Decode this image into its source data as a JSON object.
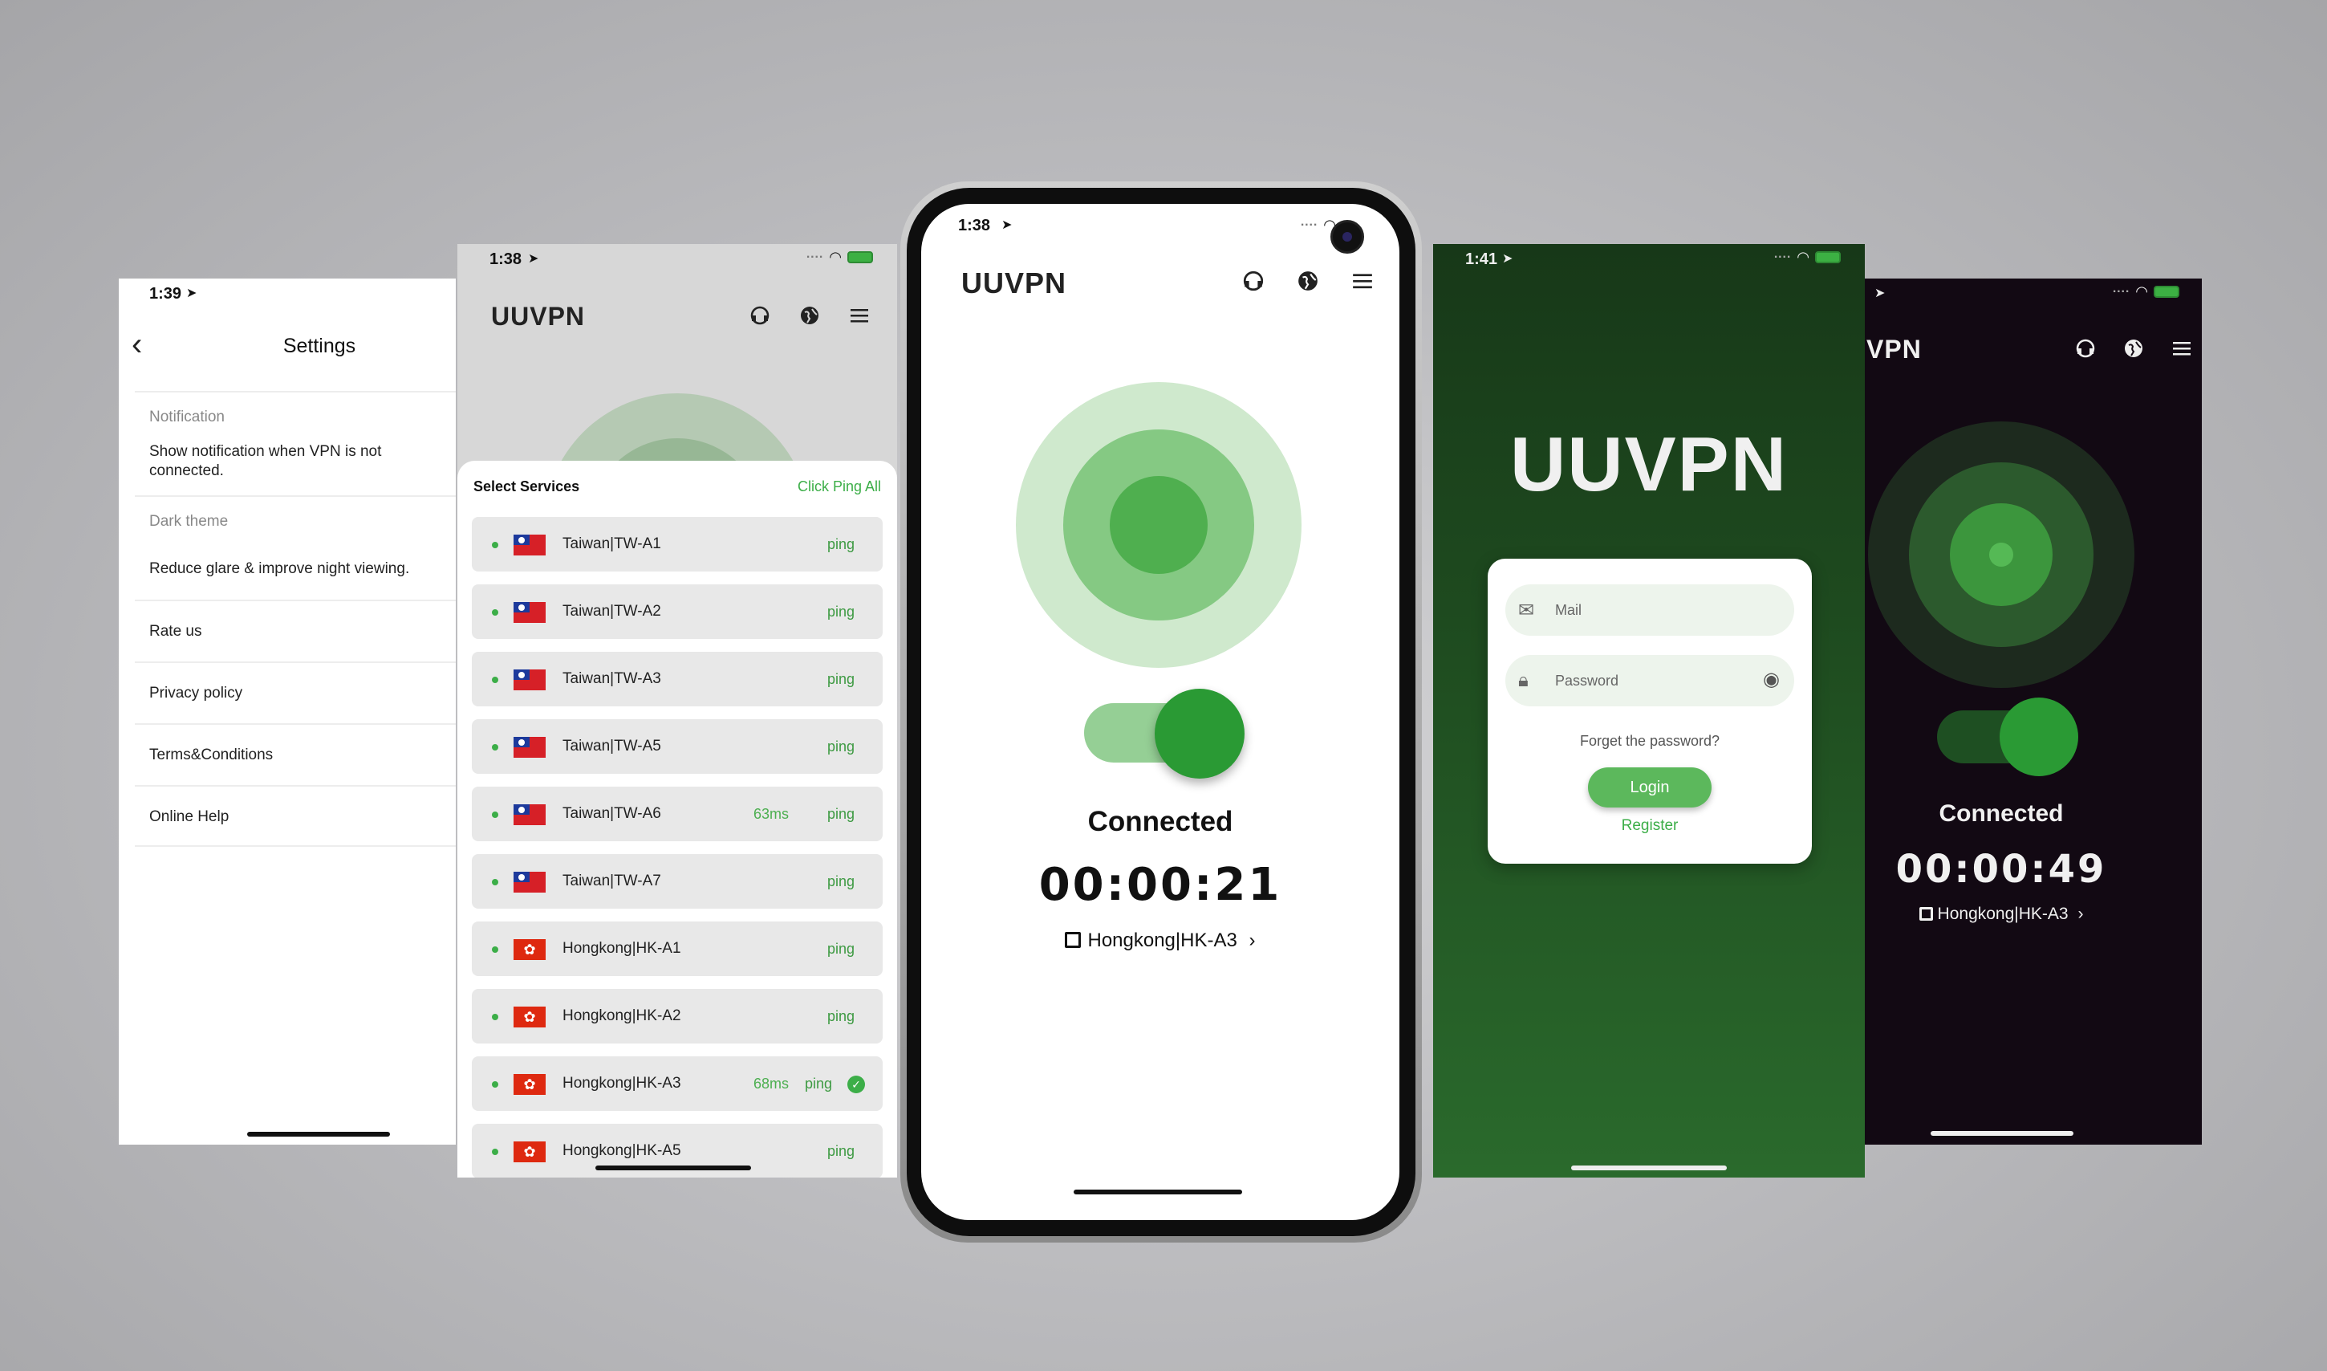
{
  "settings": {
    "time": "1:39",
    "title": "Settings",
    "back_glyph": "‹",
    "rows": [
      {
        "label": "Notification",
        "text": "Show notification when VPN is not connected."
      },
      {
        "label": "Dark theme",
        "text": "Reduce glare & improve night viewing."
      },
      {
        "label": "",
        "text": "Rate us"
      },
      {
        "label": "",
        "text": "Privacy policy"
      },
      {
        "label": "",
        "text": "Terms&Conditions"
      },
      {
        "label": "",
        "text": "Online Help"
      }
    ]
  },
  "server_list": {
    "time": "1:38",
    "brand": "UUVPN",
    "sheet_title": "Select Services",
    "ping_all": "Click Ping All",
    "servers": [
      {
        "name": "Taiwan|TW-A1",
        "latency": "",
        "action": "ping",
        "flag": "tw"
      },
      {
        "name": "Taiwan|TW-A2",
        "latency": "",
        "action": "ping",
        "flag": "tw"
      },
      {
        "name": "Taiwan|TW-A3",
        "latency": "",
        "action": "ping",
        "flag": "tw"
      },
      {
        "name": "Taiwan|TW-A5",
        "latency": "",
        "action": "ping",
        "flag": "tw"
      },
      {
        "name": "Taiwan|TW-A6",
        "latency": "63ms",
        "action": "ping",
        "flag": "tw"
      },
      {
        "name": "Taiwan|TW-A7",
        "latency": "",
        "action": "ping",
        "flag": "tw"
      },
      {
        "name": "Hongkong|HK-A1",
        "latency": "",
        "action": "ping",
        "flag": "hk"
      },
      {
        "name": "Hongkong|HK-A2",
        "latency": "",
        "action": "ping",
        "flag": "hk"
      },
      {
        "name": "Hongkong|HK-A3",
        "latency": "68ms",
        "action": "ping",
        "flag": "hk",
        "selected": true
      },
      {
        "name": "Hongkong|HK-A5",
        "latency": "",
        "action": "ping",
        "flag": "hk"
      }
    ]
  },
  "main": {
    "time": "1:38",
    "brand": "UUVPN",
    "status": "Connected",
    "timer": "00:00:21",
    "location": "Hongkong|HK-A3",
    "chevron": "›"
  },
  "login": {
    "time": "1:41",
    "logo": "UUVPN",
    "mail_placeholder": "Mail",
    "password_placeholder": "Password",
    "forgot": "Forget the password?",
    "login_label": "Login",
    "register_label": "Register"
  },
  "dark": {
    "brand": "VPN",
    "status": "Connected",
    "timer": "00:00:49",
    "location": "Hongkong|HK-A3",
    "chevron": "›"
  },
  "icons": {
    "nav": "location-arrow-icon",
    "wifi": "wifi-icon",
    "battery": "battery-icon",
    "support": "headset-icon",
    "globe": "globe-icon",
    "menu": "menu-icon",
    "map": "map-icon",
    "mail": "mail-icon",
    "lock": "lock-icon",
    "eye": "eye-icon",
    "check": "check-circle-icon"
  },
  "colors": {
    "accent": "#3cae48",
    "accent_dark": "#2a9a34",
    "login_bg": "#1f4d20",
    "dark_bg": "#120913"
  }
}
